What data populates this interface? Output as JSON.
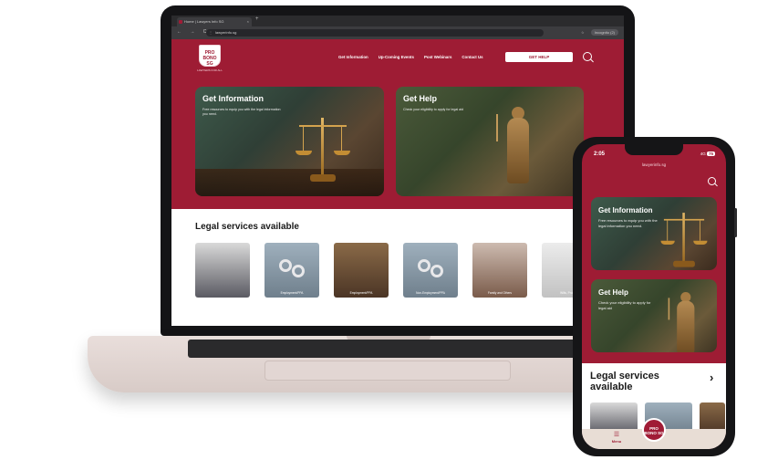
{
  "browser": {
    "tab_title": "Home | Lawyers Info SG",
    "tab_close": "×",
    "new_tab": "+",
    "nav": "← → C",
    "url": "lawyerinfo.sg",
    "lock": "⋮",
    "profile": "Incognito (2)"
  },
  "site": {
    "logo_text": "PRO BONO SG",
    "logo_sub": "LAWYERS FOR ALL",
    "nav_items": [
      "Get Information",
      "Up-Coming Events",
      "Post Webinars",
      "Contact Us"
    ],
    "get_help_label": "GET HELP",
    "cards": [
      {
        "title": "Get Information",
        "desc": "Free resources to equip you with the legal information you need."
      },
      {
        "title": "Get Help",
        "desc": "Check your eligibility to apply for legal aid"
      }
    ],
    "services_title": "Legal services available",
    "services": [
      "",
      "Employment/PPA",
      "Employment/PPA",
      "Non-Employment/PPA",
      "Family and Others",
      "Wills, Probate"
    ]
  },
  "phone": {
    "time": "2:05",
    "signal": "4G",
    "battery": "75",
    "url": "lawyerinfo.sg",
    "cards": [
      {
        "title": "Get Information",
        "desc": "Free resources to equip you with the legal information you need."
      },
      {
        "title": "Get Help",
        "desc": "Check your eligibility to apply for legal aid"
      }
    ],
    "services_title": "Legal services available",
    "arrow": "›",
    "menu_icon": "☰",
    "menu_label": "Menu",
    "logo_text": "PRO BONO SG"
  }
}
